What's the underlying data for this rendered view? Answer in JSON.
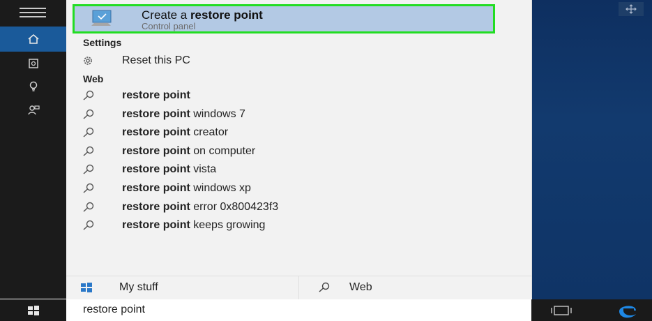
{
  "best_match": {
    "title_prefix": "Create a ",
    "title_bold": "restore point",
    "subtitle": "Control panel"
  },
  "sections": {
    "settings": "Settings",
    "web": "Web"
  },
  "settings_items": [
    {
      "label": "Reset this PC"
    }
  ],
  "web_items": [
    {
      "bold": "restore point",
      "rest": ""
    },
    {
      "bold": "restore point",
      "rest": " windows 7"
    },
    {
      "bold": "restore point",
      "rest": " creator"
    },
    {
      "bold": "restore point",
      "rest": " on computer"
    },
    {
      "bold": "restore point",
      "rest": " vista"
    },
    {
      "bold": "restore point",
      "rest": " windows xp"
    },
    {
      "bold": "restore point",
      "rest": " error 0x800423f3"
    },
    {
      "bold": "restore point",
      "rest": " keeps growing"
    }
  ],
  "scope": {
    "my_stuff": "My stuff",
    "web": "Web"
  },
  "search": {
    "value": "restore point"
  },
  "colors": {
    "highlight": "#b3c9e4",
    "highlight_border": "#22dd22",
    "rail": "#1b1b1b",
    "rail_active": "#1a5a9a",
    "edge_blue": "#1e88e5"
  }
}
